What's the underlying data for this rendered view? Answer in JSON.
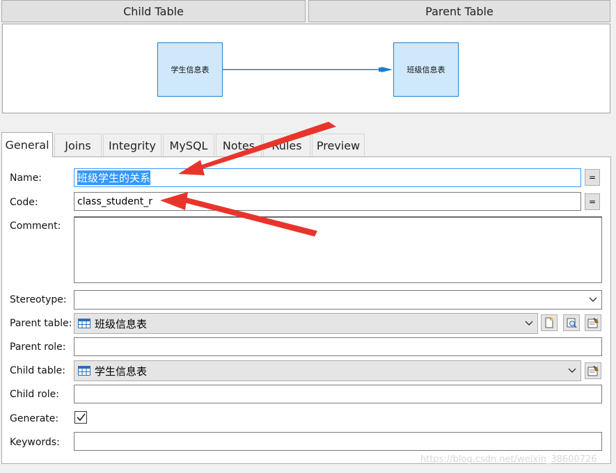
{
  "headers": {
    "child": "Child Table",
    "parent": "Parent Table"
  },
  "diagram": {
    "child_table": "学生信息表",
    "parent_table": "班级信息表"
  },
  "tabs": [
    "General",
    "Joins",
    "Integrity",
    "MySQL",
    "Notes",
    "Rules",
    "Preview"
  ],
  "form": {
    "name_label": "Name:",
    "name_value": "班级学生的关系",
    "code_label": "Code:",
    "code_value": "class_student_r",
    "comment_label": "Comment:",
    "stereotype_label": "Stereotype:",
    "parent_table_label": "Parent table:",
    "parent_table_value": "班级信息表",
    "parent_role_label": "Parent role:",
    "child_table_label": "Child table:",
    "child_table_value": "学生信息表",
    "child_role_label": "Child role:",
    "generate_label": "Generate:",
    "generate_checked": true,
    "keywords_label": "Keywords:",
    "equal_button": "="
  },
  "watermark": "https://blog.csdn.net/weixin_38600726",
  "colors": {
    "arrow": "#e8352c",
    "selection": "#3399ff",
    "table_fill": "#cfe8fb",
    "table_border": "#1e7fc9",
    "link": "#1e7fc9"
  }
}
